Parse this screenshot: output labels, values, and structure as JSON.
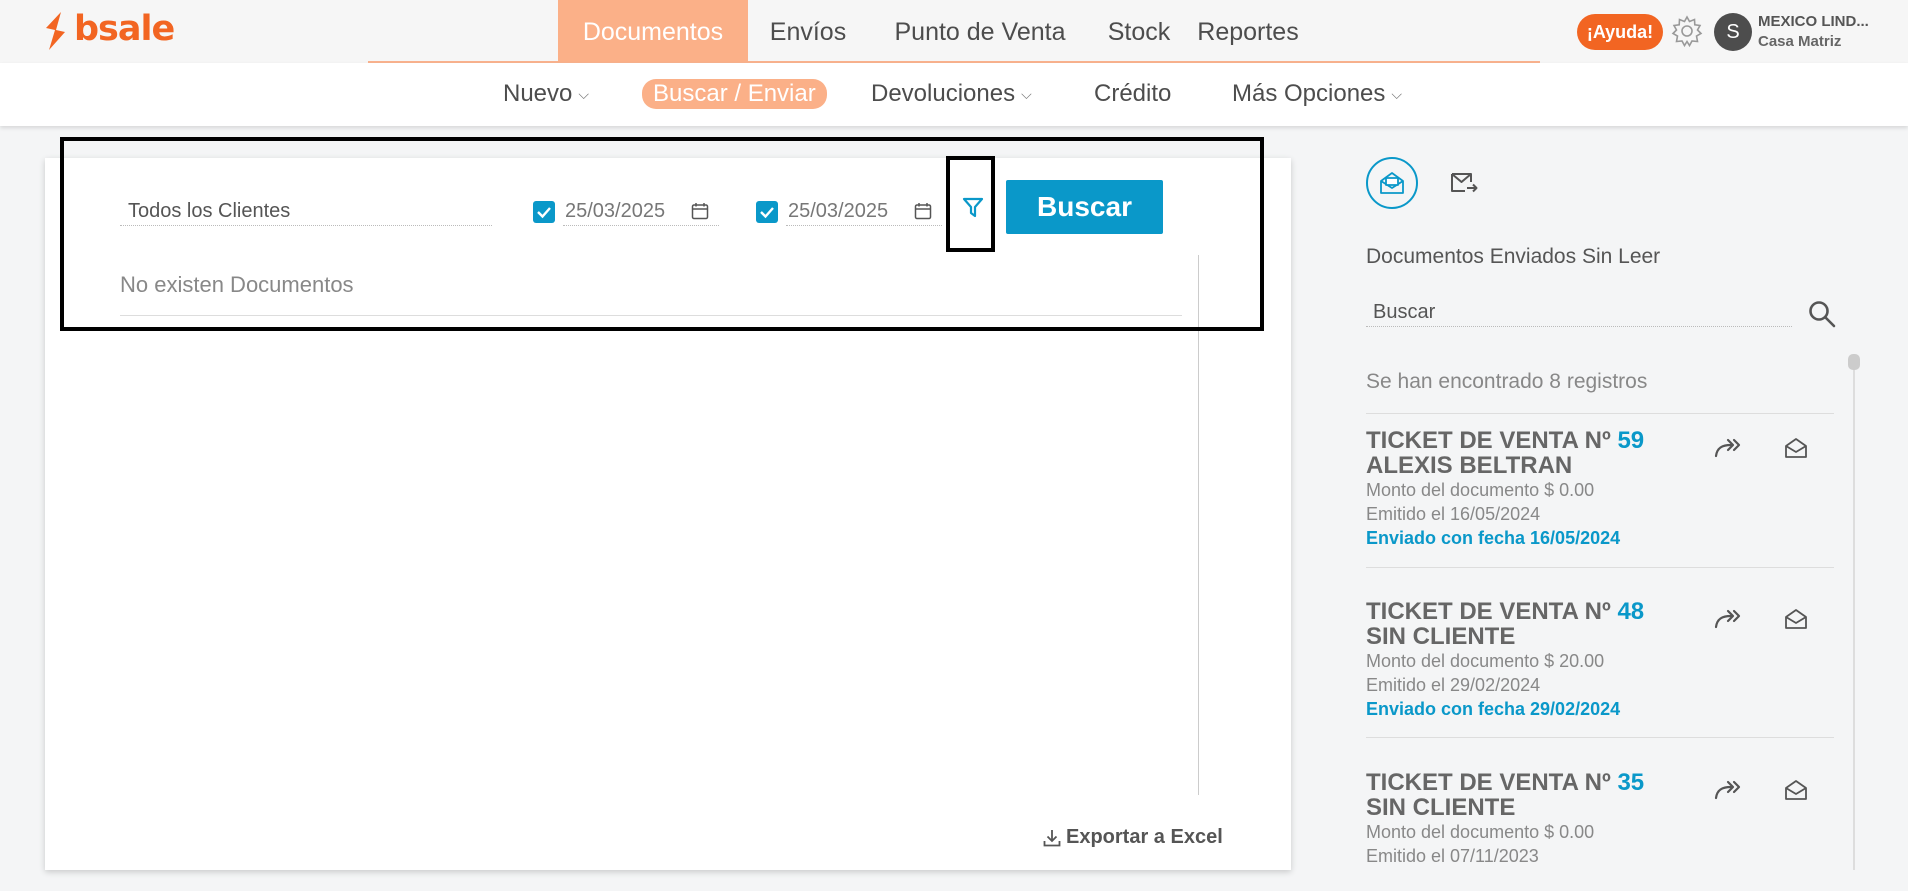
{
  "brand": {
    "logo_text": "bsale",
    "accent": "#f26522",
    "primary": "#0a98c9",
    "active_nav": "#fbb088"
  },
  "main_nav": {
    "items": [
      "Documentos",
      "Envíos",
      "Punto de Venta",
      "Stock",
      "Reportes"
    ],
    "active": "Documentos"
  },
  "header": {
    "help_label": "¡Ayuda!",
    "avatar_initial": "S",
    "company_name": "MEXICO LIND...",
    "branch_name": "Casa Matriz"
  },
  "sub_nav": {
    "items": [
      "Nuevo",
      "Buscar / Enviar",
      "Devoluciones",
      "Crédito",
      "Más Opciones"
    ],
    "active": "Buscar / Enviar"
  },
  "search_form": {
    "client_value": "Todos los Clientes",
    "date_from": "25/03/2025",
    "date_to": "25/03/2025",
    "date_from_checked": true,
    "date_to_checked": true,
    "search_label": "Buscar"
  },
  "results": {
    "empty_message": "No existen Documentos",
    "export_label": "Exportar a Excel"
  },
  "sidebar": {
    "title": "Documentos Enviados Sin Leer",
    "search_placeholder": "Buscar",
    "found_text": "Se han encontrado 8 registros",
    "tickets": [
      {
        "title": "TICKET DE VENTA Nº",
        "number": "59",
        "client": "ALEXIS BELTRAN",
        "amount": "Monto del documento $ 0.00",
        "issued": "Emitido el 16/05/2024",
        "sent": "Enviado con fecha 16/05/2024"
      },
      {
        "title": "TICKET DE VENTA Nº",
        "number": "48",
        "client": "SIN CLIENTE",
        "amount": "Monto del documento $ 20.00",
        "issued": "Emitido el 29/02/2024",
        "sent": "Enviado con fecha 29/02/2024"
      },
      {
        "title": "TICKET DE VENTA Nº",
        "number": "35",
        "client": "SIN CLIENTE",
        "amount": "Monto del documento $ 0.00",
        "issued": "Emitido el 07/11/2023"
      }
    ]
  }
}
